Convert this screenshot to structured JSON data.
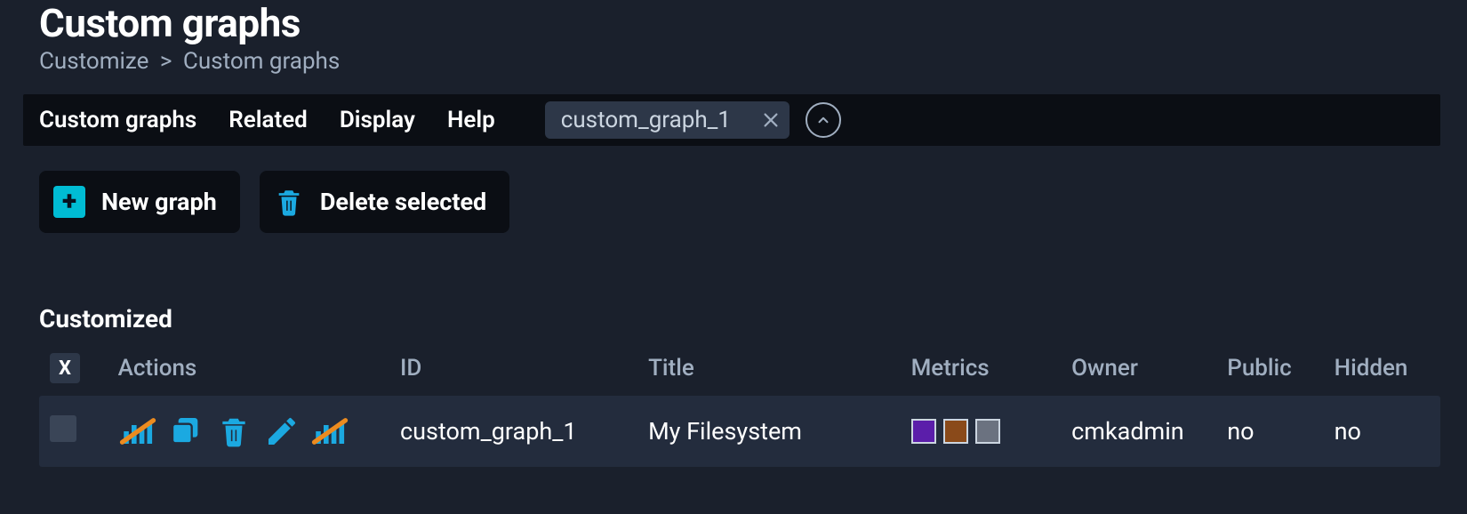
{
  "header": {
    "title": "Custom graphs",
    "breadcrumb": [
      "Customize",
      "Custom graphs"
    ]
  },
  "menubar": {
    "items": [
      "Custom graphs",
      "Related",
      "Display",
      "Help"
    ],
    "search_value": "custom_graph_1"
  },
  "actions": {
    "new_graph": "New graph",
    "delete_selected": "Delete selected"
  },
  "section": {
    "title": "Customized"
  },
  "table": {
    "columns": {
      "select_all_label": "X",
      "actions": "Actions",
      "id": "ID",
      "title": "Title",
      "metrics": "Metrics",
      "owner": "Owner",
      "public": "Public",
      "hidden": "Hidden"
    },
    "rows": [
      {
        "id": "custom_graph_1",
        "title": "My Filesystem",
        "metrics_colors": [
          "#5b1eaa",
          "#8a4a1a",
          "#6b7280"
        ],
        "owner": "cmkadmin",
        "public": "no",
        "hidden": "no"
      }
    ]
  },
  "colors": {
    "accent": "#00bcd4",
    "icon_blue": "#1ba9e1",
    "icon_orange": "#ec8b1f"
  }
}
